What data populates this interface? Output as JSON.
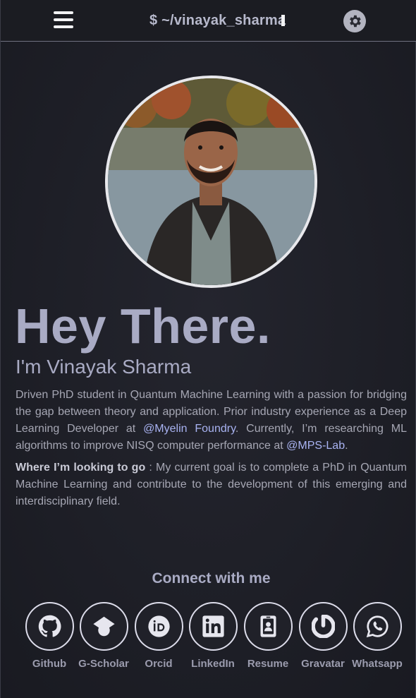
{
  "header": {
    "title": "$ ~/vinayak_sharma",
    "menu_icon": "hamburger-icon",
    "theme_icon": "gear-icon"
  },
  "hero": {
    "headline": "Hey There.",
    "name": "I'm Vinayak Sharma",
    "bio_part1": "Driven PhD student in Quantum Machine Learning with a passion for bridging the gap between theory and application. Prior industry experience as a Deep Learning Developer at ",
    "bio_link1": "@Myelin Foundry",
    "bio_part2": ". Currently, I’m researching ML algorithms to improve NISQ computer performance at ",
    "bio_link2": "@MPS-Lab",
    "bio_part3": ".",
    "goal_label": "Where I’m looking to go",
    "goal_text": " : My current goal is to complete a PhD in Quantum Machine Learning and contribute to the development of this emerging and interdisciplinary field."
  },
  "connect": {
    "title": "Connect with me",
    "links": [
      {
        "label": "Github",
        "icon": "github-icon"
      },
      {
        "label": "G-Scholar",
        "icon": "graduation-cap-icon"
      },
      {
        "label": "Orcid",
        "icon": "orcid-icon"
      },
      {
        "label": "LinkedIn",
        "icon": "linkedin-icon"
      },
      {
        "label": "Resume",
        "icon": "id-badge-icon"
      },
      {
        "label": "Gravatar",
        "icon": "power-icon"
      },
      {
        "label": "Whatsapp",
        "icon": "whatsapp-icon"
      }
    ]
  },
  "colors": {
    "background": "#1f2028",
    "heading": "#a9abc4",
    "link": "#a9b3f2",
    "body_text": "#a6a7b4"
  }
}
